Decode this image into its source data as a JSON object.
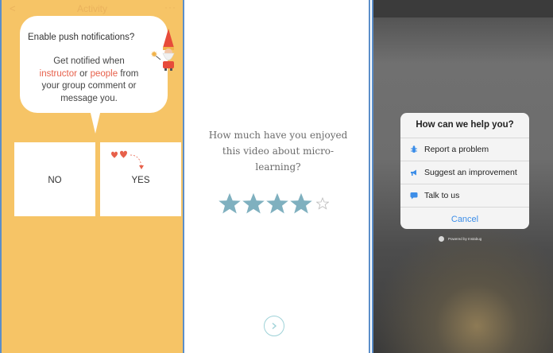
{
  "panel1": {
    "header_title": "Activity",
    "back_glyph": "<",
    "more_glyph": "···",
    "prompt_title": "Enable push notifications?",
    "message_part1": "Get notified when",
    "message_highlight1": "instructor",
    "message_connector": "or",
    "message_highlight2": "people",
    "message_part2": "from your group comment or message you.",
    "no_label": "NO",
    "yes_label": "YES",
    "highlight_color": "#e7604a",
    "background_color": "#f6c466"
  },
  "panel2": {
    "question": "How much have you enjoyed this video about micro-learning?",
    "rating": 4,
    "rating_max": 5,
    "star_color": "#7fb0bf",
    "next_icon": "chevron-right-circle-icon"
  },
  "panel3": {
    "sheet_title": "How can we help you?",
    "options": [
      {
        "label": "Report a problem",
        "icon": "bug-icon"
      },
      {
        "label": "Suggest an improvement",
        "icon": "megaphone-icon"
      },
      {
        "label": "Talk to us",
        "icon": "chat-icon"
      }
    ],
    "cancel_label": "Cancel",
    "powered_by": "Powered by Instabug",
    "accent_color": "#3d8ee8"
  }
}
